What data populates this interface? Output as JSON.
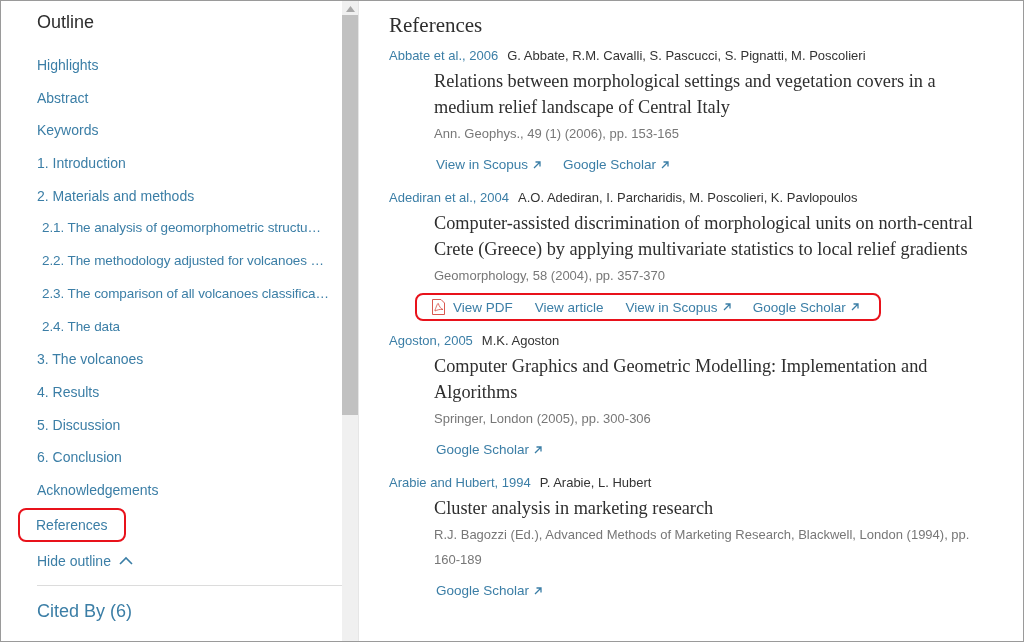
{
  "outline": {
    "title": "Outline",
    "items": [
      {
        "label": "Highlights",
        "highlighted": false
      },
      {
        "label": "Abstract",
        "highlighted": false
      },
      {
        "label": "Keywords",
        "highlighted": false
      },
      {
        "label": "1. Introduction",
        "highlighted": false
      },
      {
        "label": "2. Materials and methods",
        "highlighted": false,
        "children": [
          {
            "label": "2.1. The analysis of geomorphometric structu…",
            "highlighted": false
          },
          {
            "label": "2.2. The methodology adjusted for volcanoes …",
            "highlighted": false
          },
          {
            "label": "2.3. The comparison of all volcanoes classifica…",
            "highlighted": false
          },
          {
            "label": "2.4. The data",
            "highlighted": false
          }
        ]
      },
      {
        "label": "3. The volcanoes",
        "highlighted": false
      },
      {
        "label": "4. Results",
        "highlighted": false
      },
      {
        "label": "5. Discussion",
        "highlighted": false
      },
      {
        "label": "6. Conclusion",
        "highlighted": false
      },
      {
        "label": "Acknowledgements",
        "highlighted": false
      },
      {
        "label": "References",
        "highlighted": true
      }
    ],
    "hide_label": "Hide outline",
    "cited_by": "Cited By (6)"
  },
  "references": {
    "title": "References",
    "entries": [
      {
        "label": "Abbate et al., 2006",
        "authors": "G. Abbate, R.M. Cavalli, S. Pascucci, S. Pignatti, M. Poscolieri",
        "title": "Relations between morphological settings and vegetation covers in a medium relief landscape of Central Italy",
        "source": "Ann. Geophys., 49 (1) (2006), pp. 153-165",
        "links_highlighted": false,
        "links": [
          {
            "kind": "external",
            "label": "View in Scopus"
          },
          {
            "kind": "external",
            "label": "Google Scholar"
          }
        ]
      },
      {
        "label": "Adediran et al., 2004",
        "authors": "A.O. Adediran, I. Parcharidis, M. Poscolieri, K. Pavlopoulos",
        "title": "Computer-assisted discrimination of morphological units on north-central Crete (Greece) by applying multivariate statistics to local relief gradients",
        "source": "Geomorphology, 58 (2004), pp. 357-370",
        "links_highlighted": true,
        "links": [
          {
            "kind": "pdf",
            "label": "View PDF"
          },
          {
            "kind": "article",
            "label": "View article"
          },
          {
            "kind": "external",
            "label": "View in Scopus"
          },
          {
            "kind": "external",
            "label": "Google Scholar"
          }
        ]
      },
      {
        "label": "Agoston, 2005",
        "authors": "M.K. Agoston",
        "title": "Computer Graphics and Geometric Modelling: Implementation and Algorithms",
        "source": "Springer, London (2005), pp. 300-306",
        "links_highlighted": false,
        "links": [
          {
            "kind": "external",
            "label": "Google Scholar"
          }
        ]
      },
      {
        "label": "Arabie and Hubert, 1994",
        "authors": "P. Arabie, L. Hubert",
        "title": "Cluster analysis in marketing research",
        "source": "R.J. Bagozzi (Ed.), Advanced Methods of Marketing Research, Blackwell, London (1994), pp. 160-189",
        "links_highlighted": false,
        "links": [
          {
            "kind": "external",
            "label": "Google Scholar"
          }
        ]
      }
    ]
  }
}
